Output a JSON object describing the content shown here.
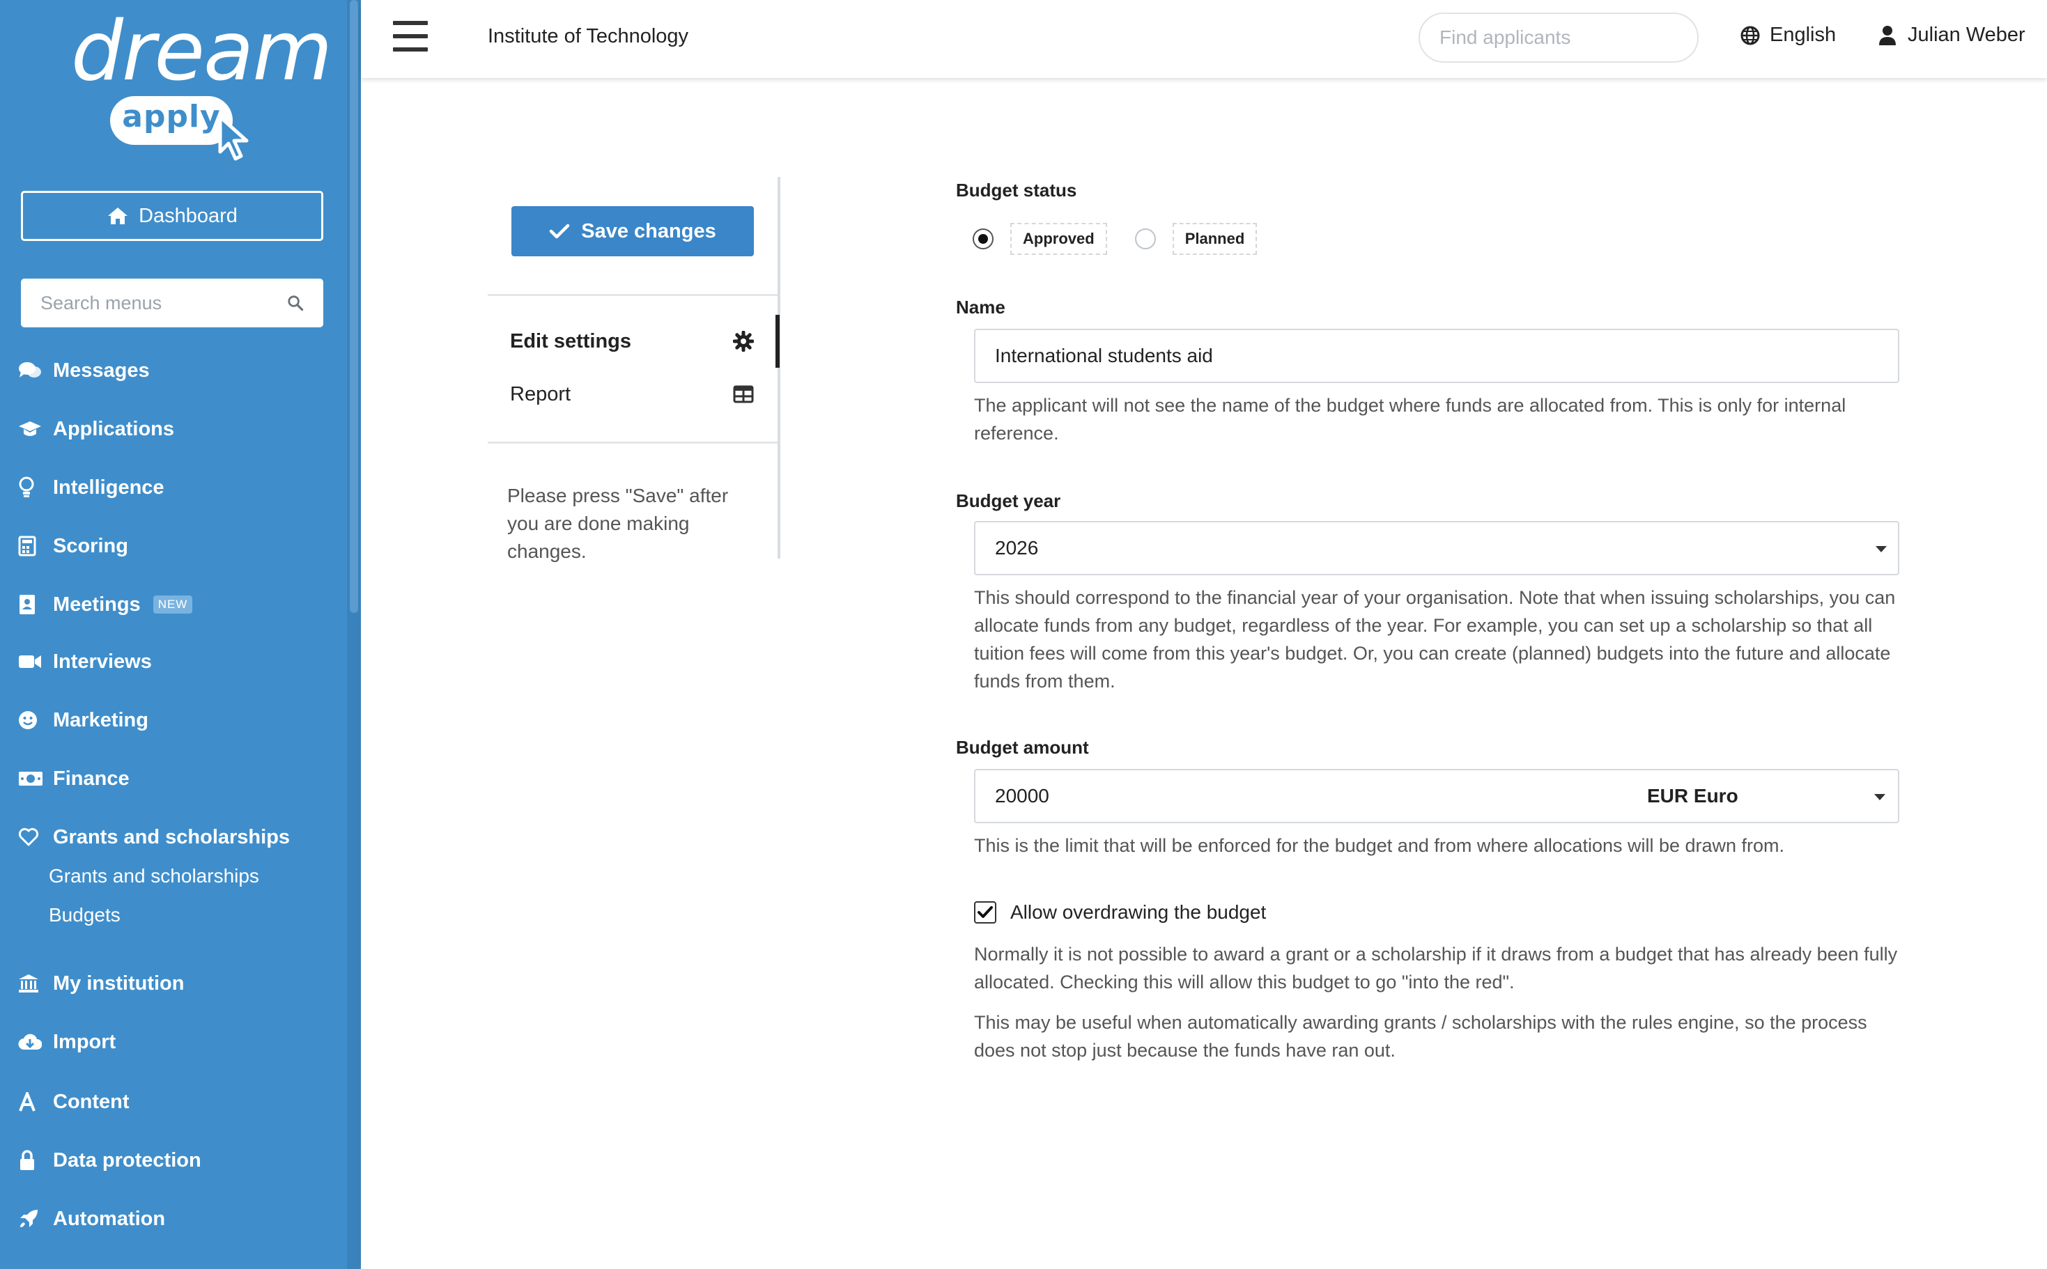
{
  "sidebar": {
    "logo_top": "dream",
    "logo_bottom": "apply",
    "dashboard_label": "Dashboard",
    "search_placeholder": "Search menus",
    "items": [
      {
        "label": "Messages",
        "icon": "comments-icon"
      },
      {
        "label": "Applications",
        "icon": "graduation-cap-icon"
      },
      {
        "label": "Intelligence",
        "icon": "lightbulb-icon"
      },
      {
        "label": "Scoring",
        "icon": "calculator-icon"
      },
      {
        "label": "Meetings",
        "icon": "address-book-icon",
        "badge": "NEW"
      },
      {
        "label": "Interviews",
        "icon": "video-camera-icon"
      },
      {
        "label": "Marketing",
        "icon": "smile-icon"
      },
      {
        "label": "Finance",
        "icon": "money-bill-icon"
      },
      {
        "label": "Grants and scholarships",
        "icon": "heart-icon"
      },
      {
        "label": "My institution",
        "icon": "institution-icon"
      },
      {
        "label": "Import",
        "icon": "cloud-download-icon"
      },
      {
        "label": "Content",
        "icon": "font-icon"
      },
      {
        "label": "Data protection",
        "icon": "lock-icon"
      },
      {
        "label": "Automation",
        "icon": "rocket-icon"
      }
    ],
    "subitems": [
      "Grants and scholarships",
      "Budgets"
    ]
  },
  "header": {
    "title": "Institute of Technology",
    "search_placeholder": "Find applicants",
    "language": "English",
    "user": "Julian Weber"
  },
  "leftpanel": {
    "save_label": "Save changes",
    "items": [
      {
        "label": "Edit settings",
        "icon": "gear-icon",
        "active": true
      },
      {
        "label": "Report",
        "icon": "table-icon",
        "active": false
      }
    ],
    "note": "Please press \"Save\" after you are done making changes."
  },
  "form": {
    "status": {
      "label": "Budget status",
      "options": [
        "Approved",
        "Planned"
      ],
      "selected": "Approved"
    },
    "name": {
      "label": "Name",
      "value": "International students aid",
      "help": "The applicant will not see the name of the budget where funds are allocated from. This is only for internal reference."
    },
    "year": {
      "label": "Budget year",
      "value": "2026",
      "help": "This should correspond to the financial year of your organisation. Note that when issuing scholarships, you can allocate funds from any budget, regardless of the year. For example, you can set up a scholarship so that all tuition fees will come from this year's budget. Or, you can create (planned) budgets into the future and allocate funds from them."
    },
    "amount": {
      "label": "Budget amount",
      "value": "20000",
      "currency": "EUR Euro",
      "help": "This is the limit that will be enforced for the budget and from where allocations will be drawn from."
    },
    "overdraw": {
      "label": "Allow overdrawing the budget",
      "checked": true,
      "help1": "Normally it is not possible to award a grant or a scholarship if it draws from a budget that has already been fully allocated. Checking this will allow this budget to go \"into the red\".",
      "help2": "This may be useful when automatically awarding grants / scholarships with the rules engine, so the process does not stop just because the funds have ran out."
    }
  },
  "colors": {
    "sidebar": "#3f8ecb",
    "primary_button": "#3a86c8"
  }
}
